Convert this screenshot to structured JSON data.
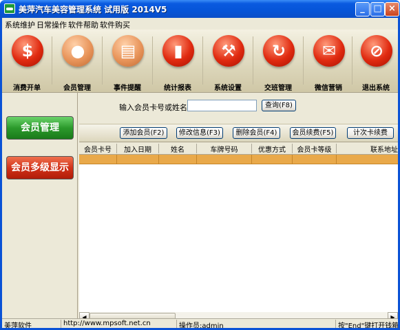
{
  "window": {
    "title": "美萍汽车美容管理系统 试用版  2014V5",
    "min_glyph": "_",
    "max_glyph": "□",
    "close_glyph": "×"
  },
  "menu": [
    "系统维护",
    "日常操作",
    "软件帮助",
    "软件购买"
  ],
  "toolbar": {
    "buttons": [
      {
        "label": "消费开单",
        "glyph": "$",
        "icon": "dollar-icon"
      },
      {
        "label": "会员管理",
        "glyph": "●",
        "icon": "person-icon"
      },
      {
        "label": "事件提醒",
        "glyph": "▤",
        "icon": "book-icon"
      },
      {
        "label": "统计报表",
        "glyph": "▮",
        "icon": "bar-chart-icon"
      },
      {
        "label": "系统设置",
        "glyph": "⚒",
        "icon": "tools-icon"
      },
      {
        "label": "交班管理",
        "glyph": "↻",
        "icon": "refresh-icon"
      },
      {
        "label": "微信营销",
        "glyph": "✉",
        "icon": "wechat-icon"
      },
      {
        "label": "退出系统",
        "glyph": "⊘",
        "icon": "exit-icon"
      }
    ]
  },
  "sidebar": {
    "member_manage": "会员管理",
    "member_multilevel": "会员多级显示"
  },
  "search": {
    "label": "输入会员卡号或姓名:",
    "value": "",
    "button": "查询(F8)"
  },
  "actions": [
    "添加会员(F2)",
    "修改信息(F3)",
    "删除会员(F4)",
    "会员续费(F5)",
    "计次卡续费"
  ],
  "table": {
    "columns": [
      "会员卡号",
      "加入日期",
      "姓名",
      "车牌号码",
      "优惠方式",
      "会员卡等级",
      "联系地址"
    ]
  },
  "status": {
    "company": "美萍软件",
    "url": "http://www.mpsoft.net.cn",
    "operator": "操作员:admin",
    "hint": "按\"End\"键打开钱箱"
  },
  "colors": {
    "title_bar": "#0554d8",
    "selected_row": "#e9a94a",
    "toolbar_icon": "#e02a10",
    "green_button": "#2c9a2c",
    "red_button": "#d2331a"
  }
}
